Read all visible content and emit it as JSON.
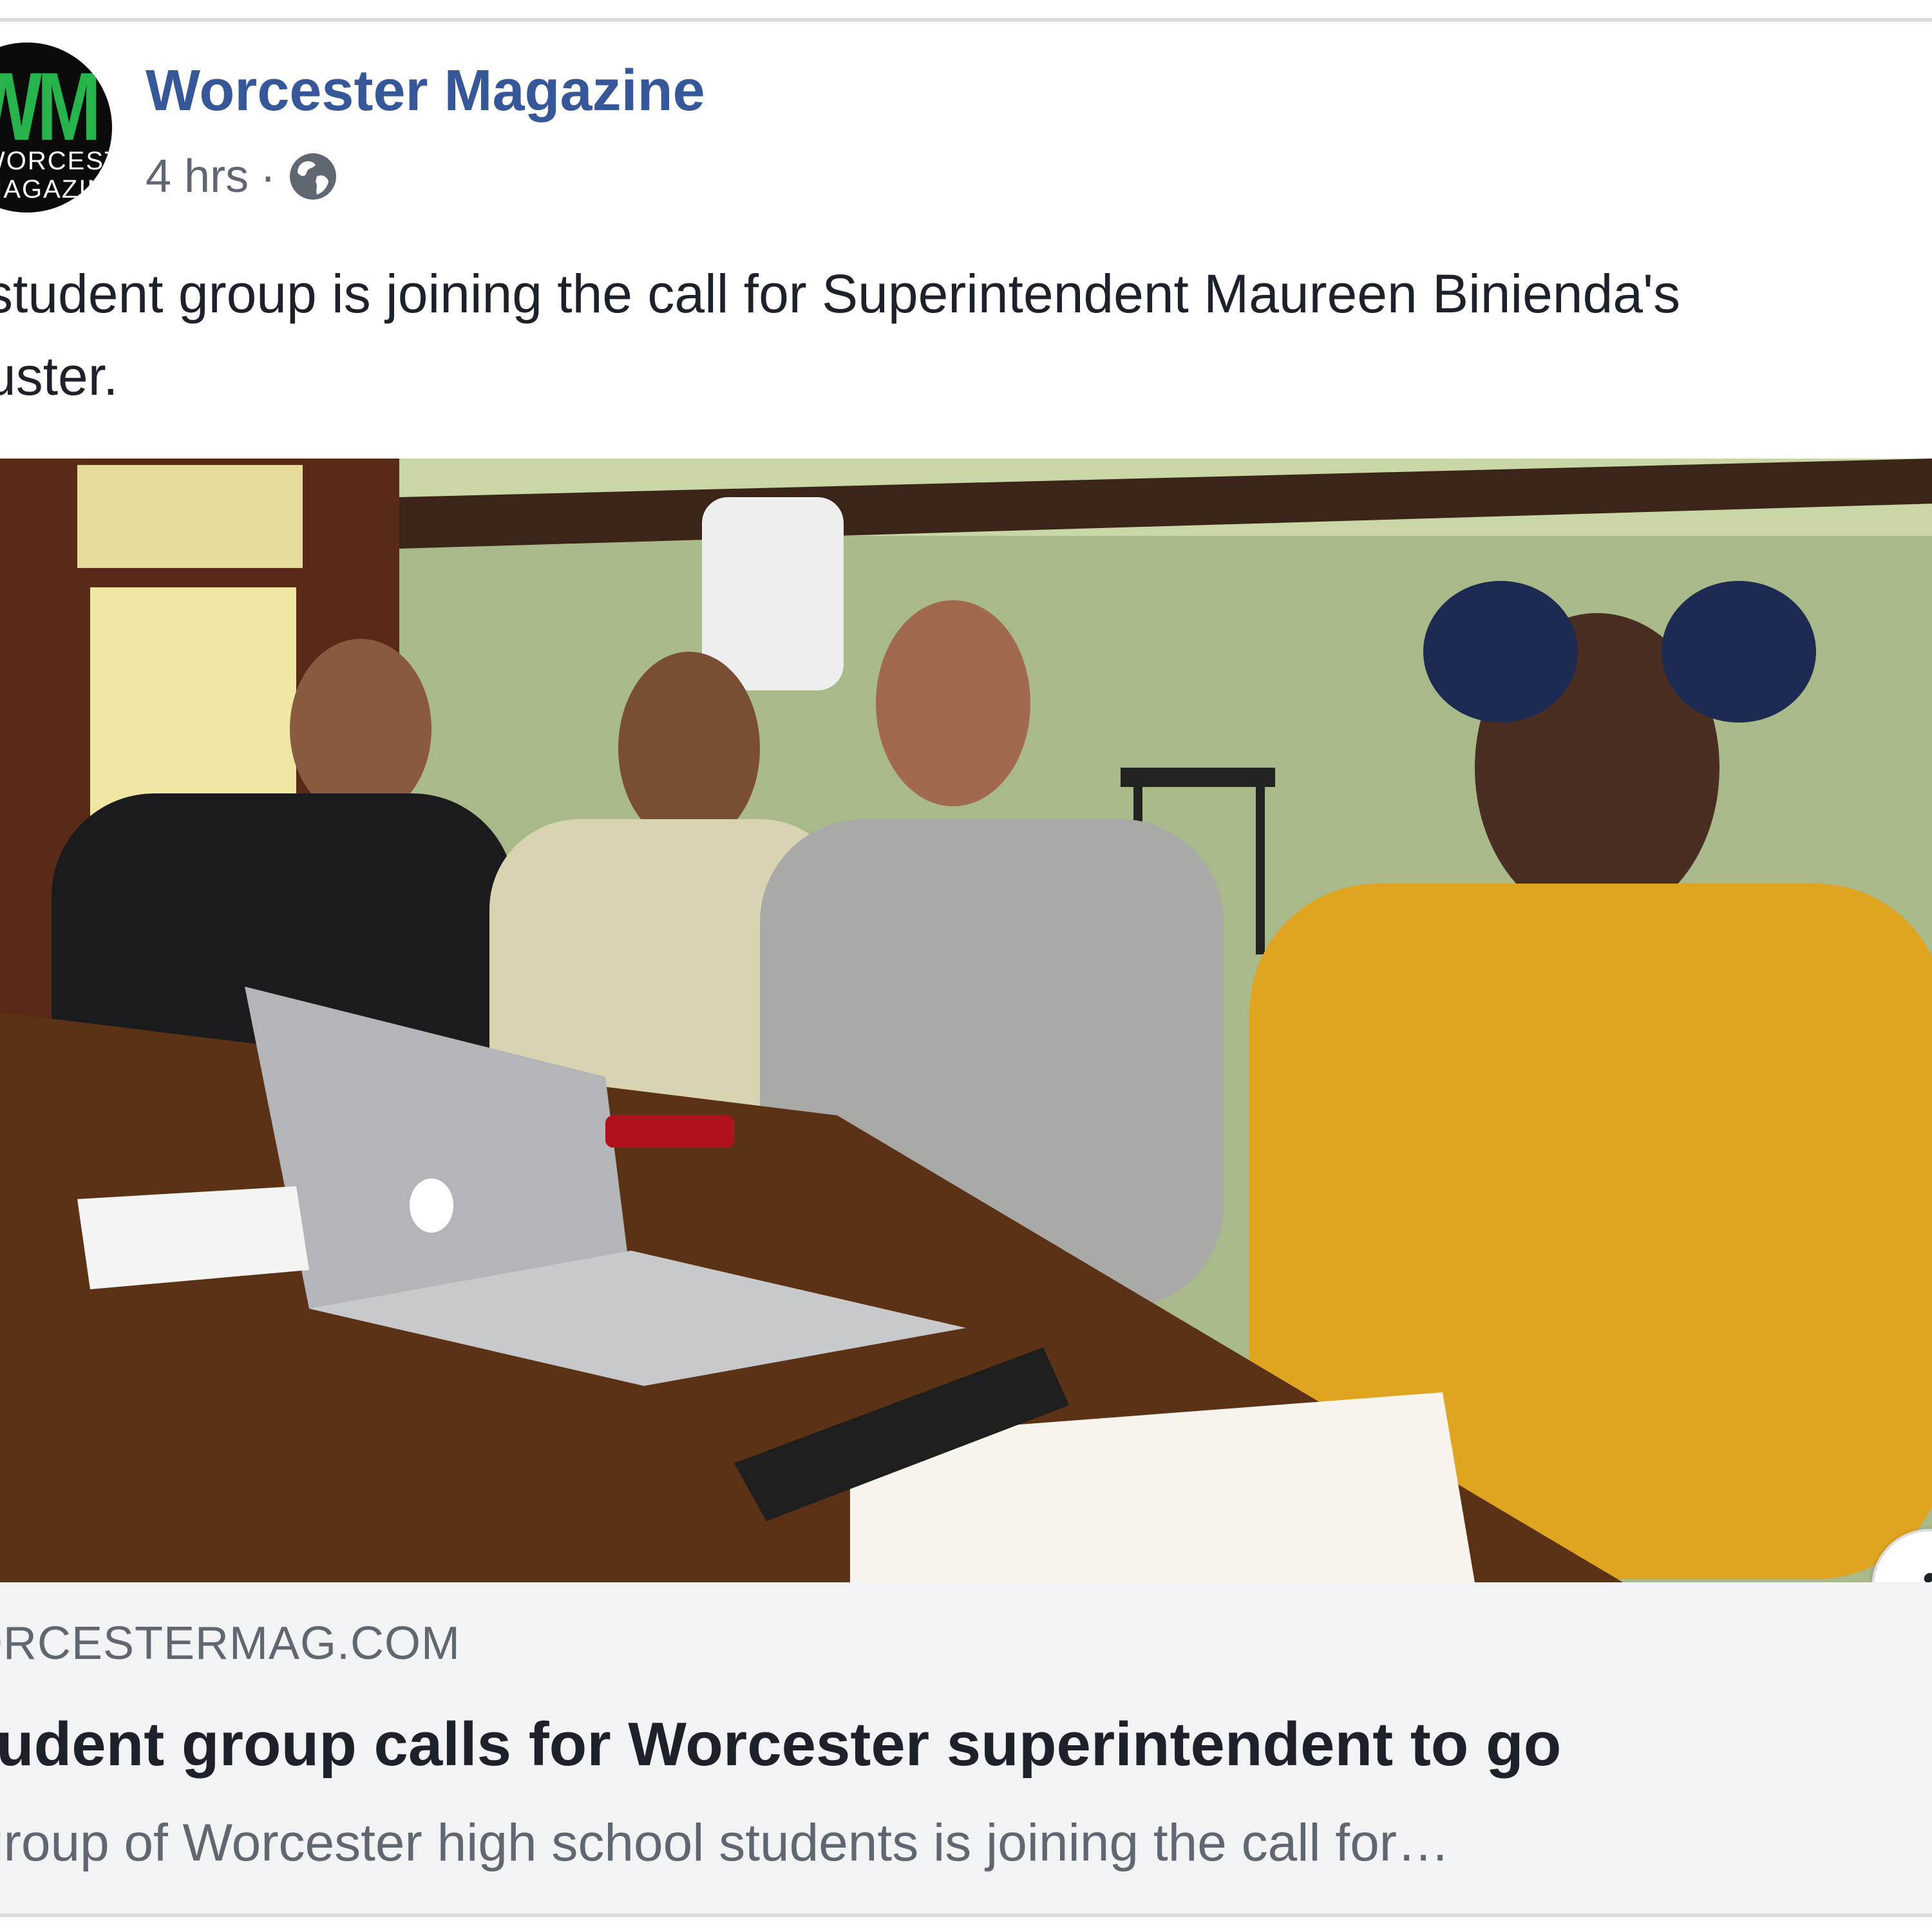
{
  "post": {
    "page_name": "Worcester Magazine",
    "timestamp": "4 hrs",
    "separator": "·",
    "audience_icon": "globe-icon",
    "text_line1": "student group is joining the call for Superintendent Maureen Binienda's",
    "text_line2": "uster."
  },
  "avatar": {
    "letters": "WM",
    "line1": "WORCESTER",
    "line2": "MAGAZINE",
    "brand_color": "#27b34b"
  },
  "link_preview": {
    "domain": "ORCESTERMAG.COM",
    "headline": "tudent group calls for Worcester superintendent to go",
    "description": "group of Worcester high school students is joining the call for…",
    "info_icon": "info-icon",
    "info_glyph": "i"
  },
  "colors": {
    "link_blue": "#365899",
    "text_dark": "#1d2129",
    "text_muted": "#606770",
    "caption_bg": "#f2f3f5"
  }
}
